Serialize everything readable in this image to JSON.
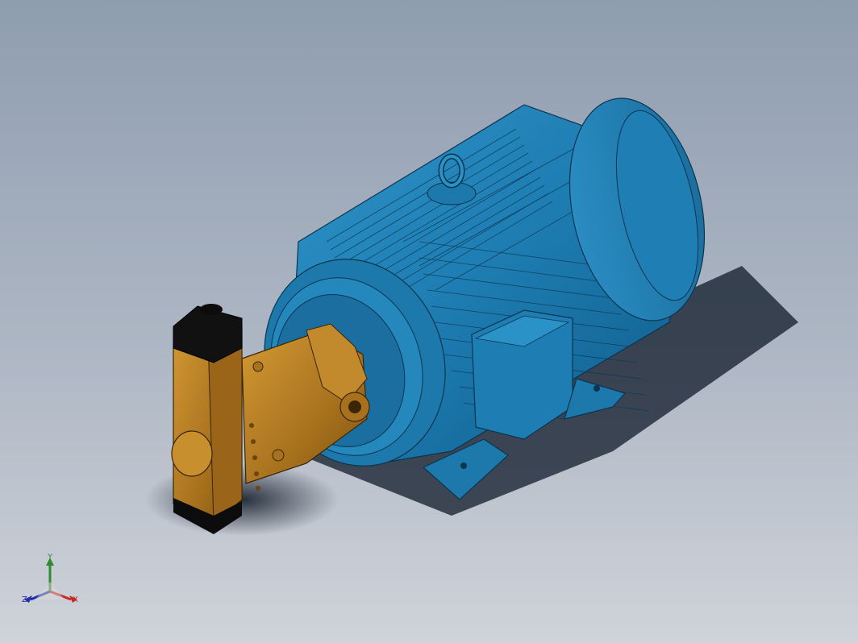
{
  "viewport": {
    "model": "motor-pump-assembly",
    "colors": {
      "background_top": "#8f9db0",
      "background_bottom": "#cfd3da",
      "motor_blue": "#1f7fb4",
      "pump_bronze": "#b07a22",
      "pump_end_black": "#0c0c0c"
    }
  },
  "triad": {
    "axis_y": "Y",
    "axis_x": "X",
    "axis_z": "Z",
    "colors": {
      "x": "#c62828",
      "y": "#2e8b2e",
      "z": "#1d2fa8"
    }
  }
}
